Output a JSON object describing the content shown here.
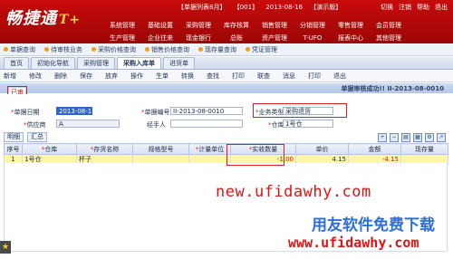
{
  "app": {
    "logo_text": "畅捷通",
    "logo_suffix": "T+",
    "status": [
      "【单据列表8月】",
      "【001】",
      "2013-08-16",
      "【演示版】"
    ],
    "system_buttons": [
      "切换",
      "注销",
      "帮助",
      "退出"
    ]
  },
  "menu": {
    "row1": [
      "系统管理",
      "基础设置",
      "采购管理",
      "库存核算",
      "销售管理",
      "分销管理",
      "零售管理",
      "会员管理"
    ],
    "row2": [
      "生产管理",
      "企业往来",
      "现金银行",
      "总账",
      "资产管理",
      "T-UFO",
      "报表中心",
      "其他管理"
    ]
  },
  "quickbar": [
    "单据查询",
    "待审核业务",
    "采购价格查询",
    "销售价格查询",
    "现存量查询",
    "凭证管理"
  ],
  "tabs": [
    "首页",
    "初始化导航",
    "采购管理",
    "采购入库单",
    "进货单"
  ],
  "commands": [
    "新增",
    "修改",
    "删除",
    "保存",
    "放弃",
    "操作",
    "生单",
    "转换",
    "查找",
    "打印",
    "联查",
    "消息",
    "打印",
    "退出"
  ],
  "document": {
    "title": "单据审核成功!! II-2013-08-0010",
    "status_badge": "已审",
    "fields": {
      "date_label": "单据日期",
      "date_value": "2013-08-16",
      "number_label": "单据编号",
      "number_value": "II-2013-08-0010",
      "biz_type_label": "业务类型",
      "biz_type_value": "采购退货",
      "supplier_label": "供应商",
      "supplier_value": "A",
      "handler_label": "经手人",
      "handler_value": "",
      "warehouse_label": "仓库",
      "warehouse_value": "1号仓"
    }
  },
  "grid": {
    "tools": [
      "明细",
      "汇总"
    ],
    "icons": [
      "add-row-icon",
      "delete-row-icon",
      "copy-icon",
      "paste-icon",
      "settings-icon",
      "export-icon"
    ],
    "headers": [
      "序号",
      "仓库",
      "存货名称",
      "规格型号",
      "计量单位",
      "实收数量",
      "单价",
      "金额",
      "现存量"
    ],
    "rows": [
      [
        "1",
        "1号仓",
        "杯子",
        "",
        "",
        "-1.00",
        "4.15",
        "-4.15",
        ""
      ]
    ]
  },
  "watermark": {
    "line1": "new.ufidawhy.com",
    "line2": "用友软件免费下载",
    "line3": "www.ufidawhy.com"
  },
  "colors": {
    "brand_red": "#c80b0b",
    "highlight_yellow": "#fff7a8",
    "annotation_red": "#e21c1c"
  }
}
